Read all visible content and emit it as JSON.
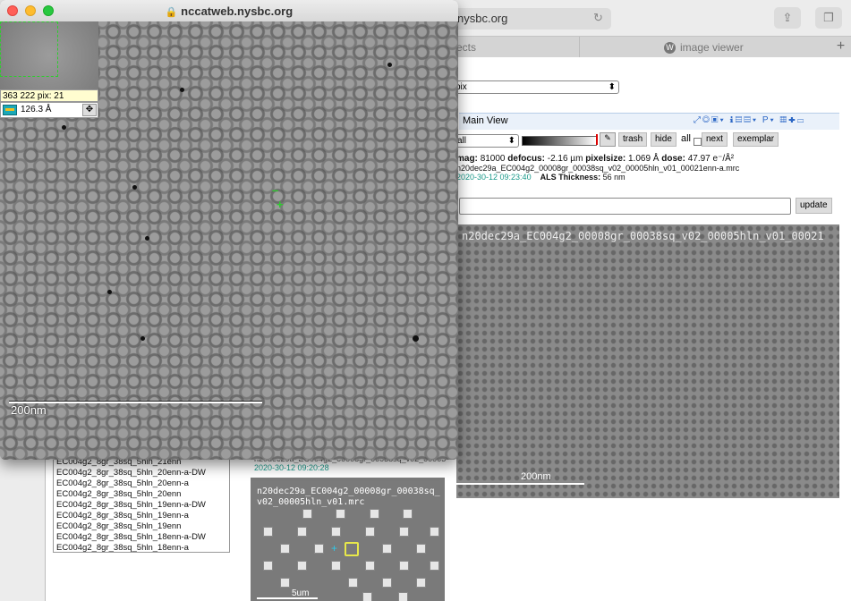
{
  "back_window": {
    "url": "nysbc.org",
    "tabs": [
      {
        "label": "ects"
      },
      {
        "label": "image viewer"
      }
    ],
    "preset_select": "pix",
    "main_view_label": "Main View",
    "filter_select": "all",
    "buttons": {
      "trash": "trash",
      "hide": "hide",
      "all": "all",
      "next": "next",
      "exemplar": "exemplar",
      "update": "update"
    },
    "image_info": {
      "mag_label": "mag:",
      "mag": "81000",
      "defocus_label": "defocus:",
      "defocus": "-2.16 µm",
      "pixelsize_label": "pixelsize:",
      "pixelsize": "1.069 Å",
      "dose_label": "dose:",
      "dose": "47.97 e⁻/Å²",
      "filename": "n20dec29a_EC004g2_00008gr_00038sq_v02_00005hln_v01_00021enn-a.mrc",
      "timestamp": "2020-30-12 09:23:40",
      "als_label": "ALS Thickness:",
      "als": "56 nm"
    },
    "image_label": "n20dec29a_EC004g2_00008gr_00038sq_v02_00005hln_v01_00021",
    "image_scale": "200nm",
    "list_items": [
      "EC004g2_8gr_38sq_5hln_21enn",
      "EC004g2_8gr_38sq_5hln_20enn-a-DW",
      "EC004g2_8gr_38sq_5hln_20enn-a",
      "EC004g2_8gr_38sq_5hln_20enn",
      "EC004g2_8gr_38sq_5hln_19enn-a-DW",
      "EC004g2_8gr_38sq_5hln_19enn-a",
      "EC004g2_8gr_38sq_5hln_19enn",
      "EC004g2_8gr_38sq_5hln_18enn-a-DW",
      "EC004g2_8gr_38sq_5hln_18enn-a"
    ],
    "atlas_header": "n20dec29a_EC004g2_00008gr_00038sq_v02_00005",
    "atlas_timestamp": "2020-30-12 09:20:28",
    "atlas_label": "n20dec29a_EC004g2_00008gr_00038sq_v02_00005hln_v01.mrc",
    "atlas_scale": "5um"
  },
  "popup": {
    "url": "nccatweb.nysbc.org",
    "readout": "363 222 pix: 21",
    "measure": "126.3 Å",
    "scale": "200nm"
  }
}
